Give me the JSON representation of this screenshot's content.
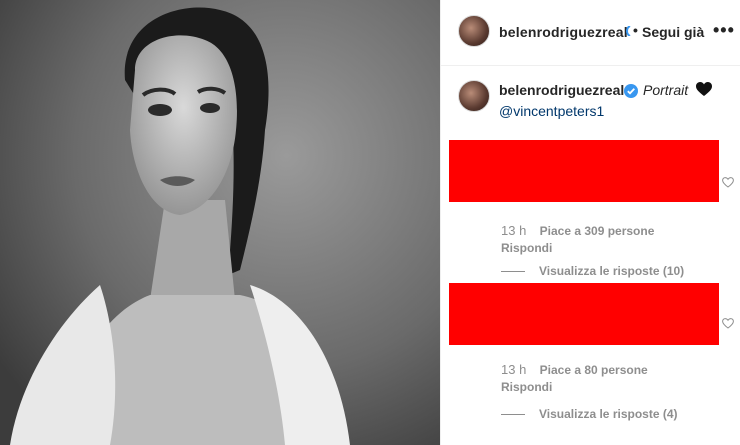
{
  "post": {
    "image_icon": "portrait-photo-image"
  },
  "header": {
    "username": "belenrodriguezreal",
    "separator": "•",
    "follow_label": "Segui già",
    "more_label": "•••"
  },
  "caption": {
    "username": "belenrodriguezreal",
    "text": "Portrait",
    "mention": "@vincentpeters1"
  },
  "comments": [
    {
      "time": "13 h",
      "likes": "Piace a 309 persone",
      "reply_label": "Rispondi",
      "view_replies": "Visualizza le risposte (10)"
    },
    {
      "time": "13 h",
      "likes": "Piace a 80 persone",
      "reply_label": "Rispondi",
      "view_replies": "Visualizza le risposte (4)"
    }
  ],
  "colors": {
    "verified": "#3897f0",
    "redaction": "#ff0000",
    "meta_text": "#8e8e8e",
    "link": "#00376b"
  }
}
